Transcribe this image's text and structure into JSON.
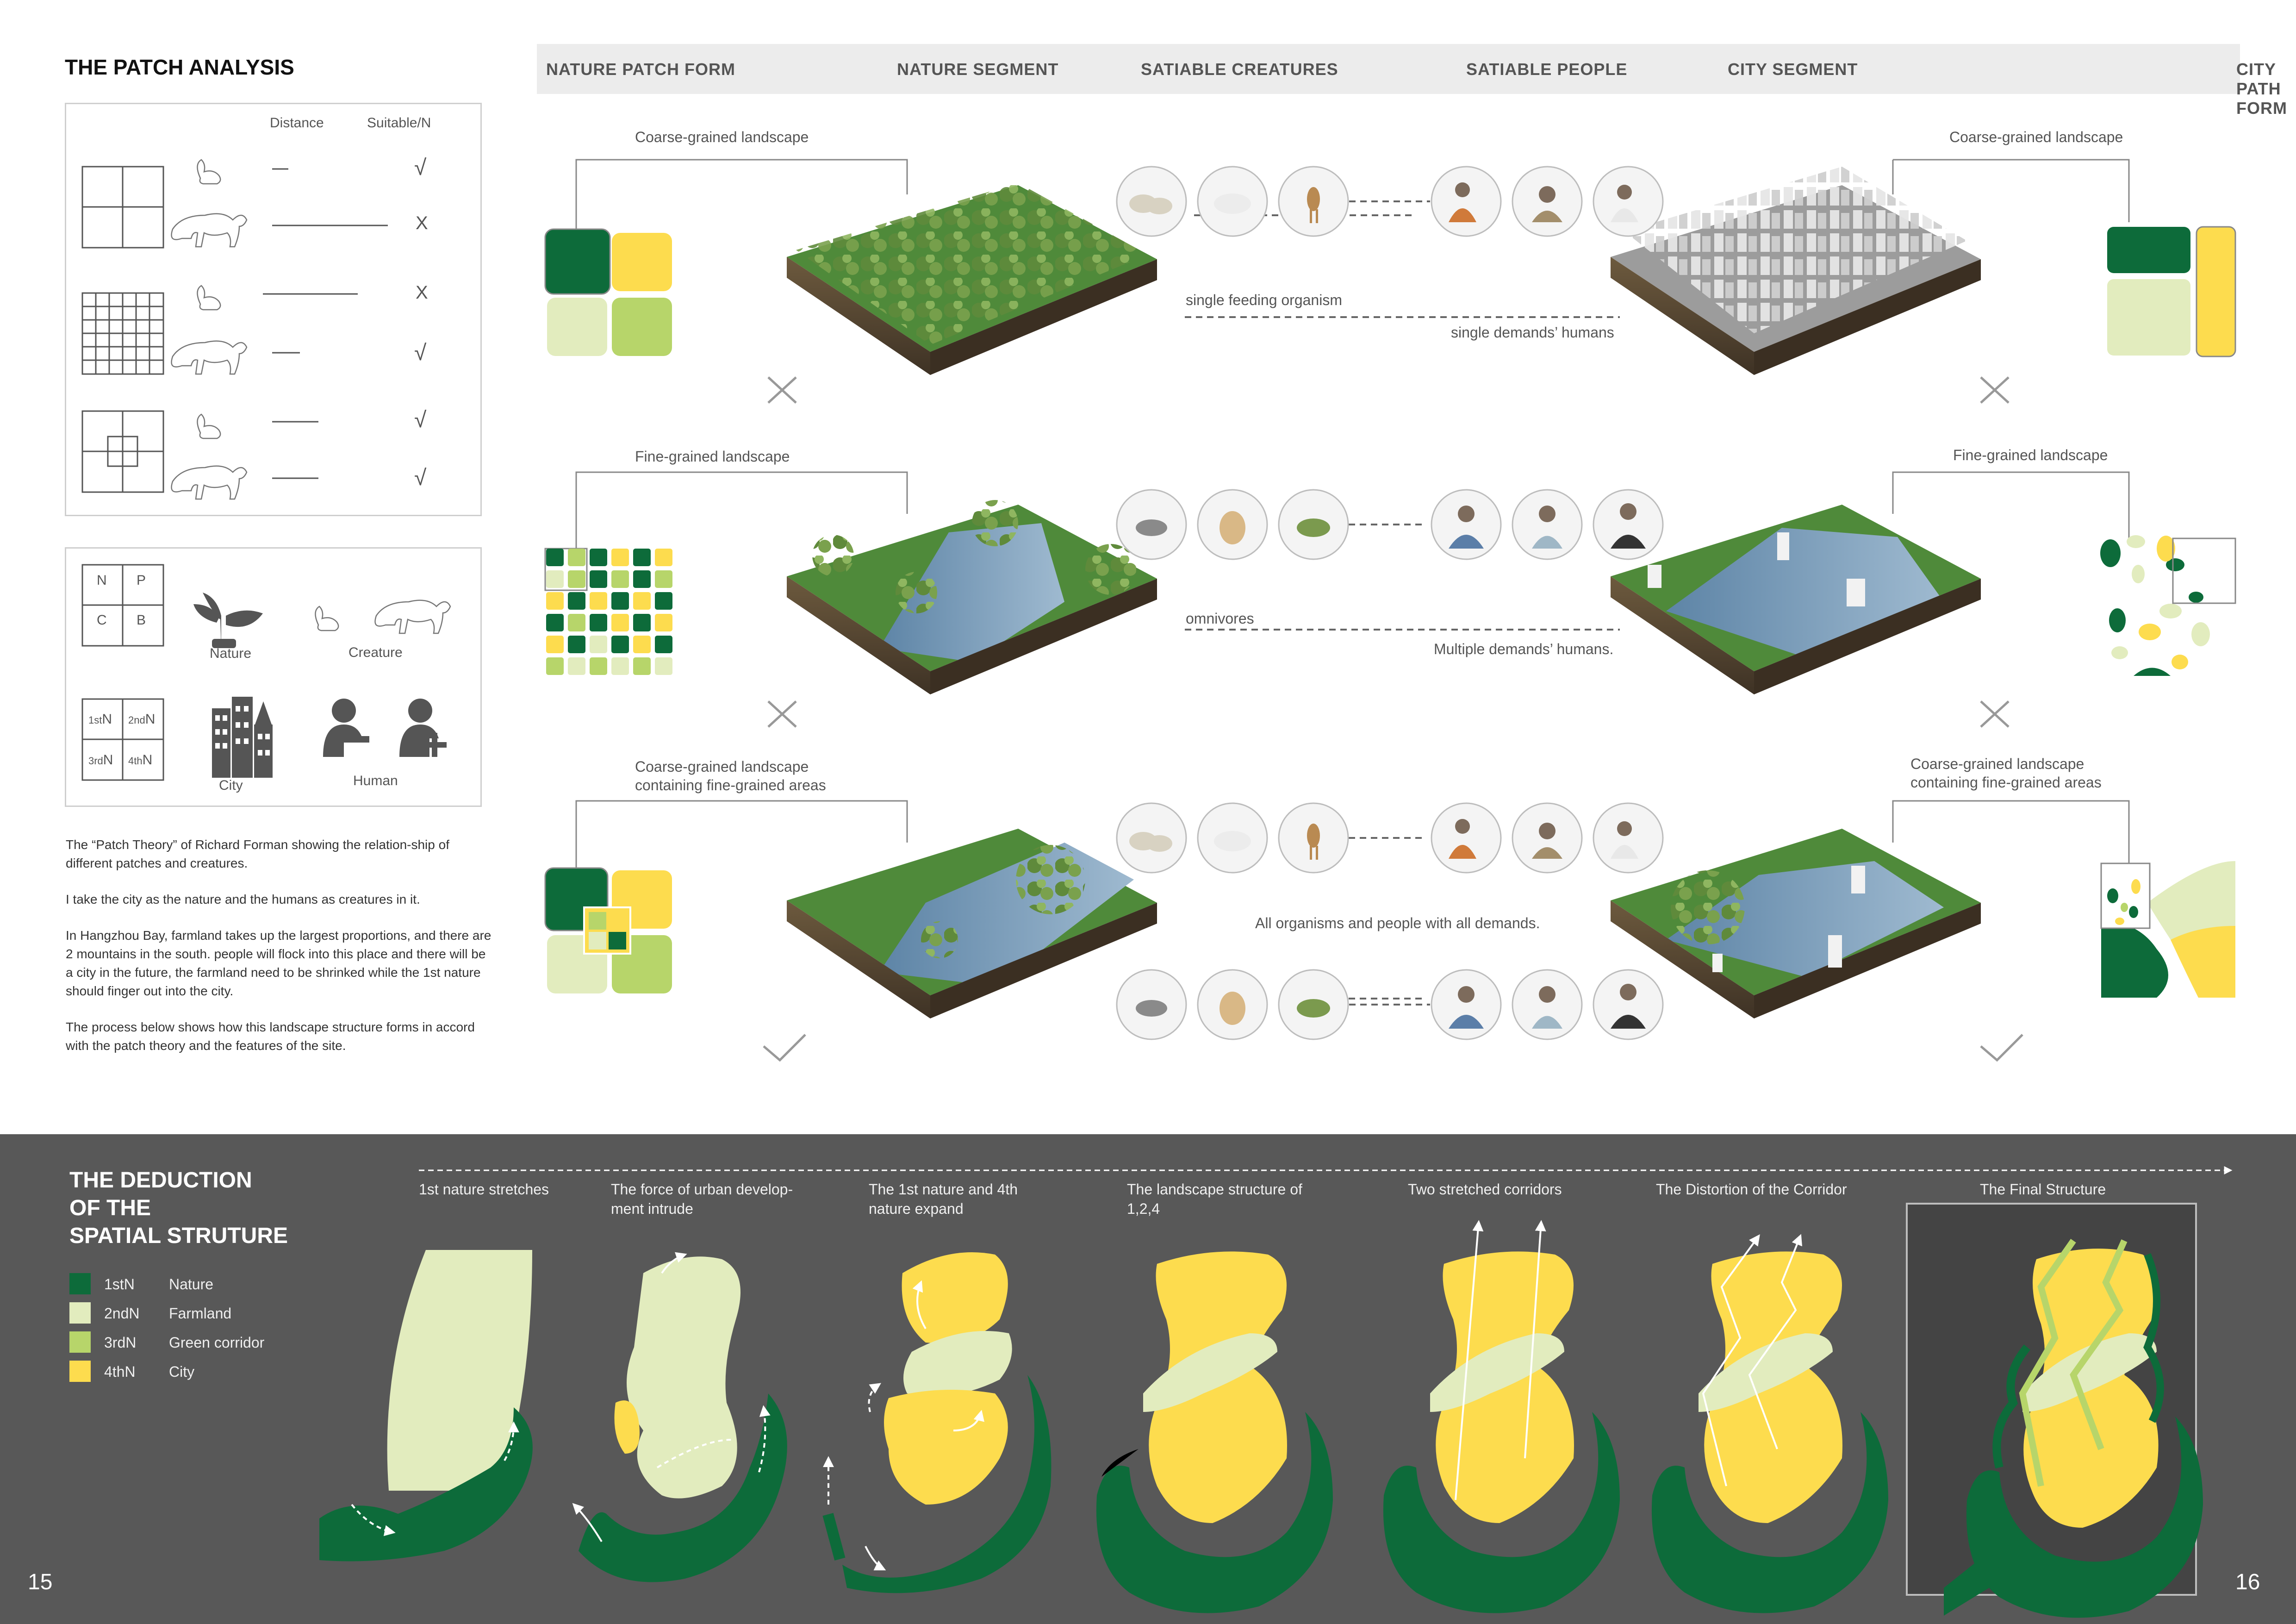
{
  "patch_analysis": {
    "title": "THE PATCH ANALYSIS",
    "col_distance": "Distance",
    "col_suitable": "Suitable/N",
    "rows": [
      {
        "animal": "rabbit-icon",
        "mark": "√"
      },
      {
        "animal": "cougar-icon",
        "mark": "X"
      },
      {
        "animal": "rabbit-icon",
        "mark": "X"
      },
      {
        "animal": "cougar-icon",
        "mark": "√"
      },
      {
        "animal": "rabbit-icon",
        "mark": "√"
      },
      {
        "animal": "cougar-icon",
        "mark": "√"
      }
    ]
  },
  "legend_box": {
    "grid_labels": [
      "N",
      "P",
      "C",
      "B"
    ],
    "nature_label": "Nature",
    "creature_label": "Creature",
    "grid2_labels": [
      "1st",
      "N",
      "2nd",
      "N",
      "3rd",
      "N",
      "4th",
      "N"
    ],
    "city_label": "City",
    "human_label": "Human"
  },
  "text_paragraphs": [
    "The “Patch Theory” of Richard Forman showing the relation-ship of different patches and creatures.",
    "I take the city as the nature and the humans as creatures in it.",
    "In Hangzhou Bay, farmland takes up the largest proportions, and there are 2 mountains in the south. people will flock into this place and there will be a city in the future, the farmland need to be shrinked while the 1st nature should finger out into the city.",
    "The process below shows how this landscape structure forms in accord with the patch theory and the features of the site."
  ],
  "header_columns": [
    "NATURE PATCH FORM",
    "NATURE SEGMENT",
    "SATIABLE CREATURES",
    "SATIABLE PEOPLE",
    "CITY SEGMENT",
    "CITY PATH FORM"
  ],
  "rows": [
    {
      "left_label": "Coarse-grained landscape",
      "right_label": "Coarse-grained landscape",
      "mid_top": "single feeding organism",
      "mid_bottom": "single demands’ humans",
      "mark": "✕"
    },
    {
      "left_label": "Fine-grained landscape",
      "right_label": "Fine-grained landscape",
      "mid_top": "omnivores",
      "mid_bottom": "Multiple demands’ humans.",
      "mark": "✕"
    },
    {
      "left_label": "Coarse-grained landscape containing fine-grained areas",
      "right_label": "Coarse-grained landscape containing fine-grained areas",
      "mid_top": "All organisms and people with all demands.",
      "mid_bottom": "",
      "mark": "✓"
    }
  ],
  "deduction": {
    "title_lines": [
      "THE DEDUCTION",
      "OF THE",
      "SPATIAL STRUTURE"
    ],
    "legend": [
      {
        "code": "1stN",
        "name": "Nature",
        "color": "#0d6b3a"
      },
      {
        "code": "2ndN",
        "name": "Farmland",
        "color": "#e2ecbe"
      },
      {
        "code": "3rdN",
        "name": "Green corridor",
        "color": "#b7d56a"
      },
      {
        "code": "4thN",
        "name": "City",
        "color": "#fddc4e"
      }
    ],
    "steps": [
      "1st nature stretches",
      "The force of urban develop-ment intrude",
      "The 1st nature and 4th nature expand",
      "The landscape structure of 1,2,4",
      "Two stretched corridors",
      "The Distortion of the Corridor",
      "The Final Structure"
    ]
  },
  "page_numbers": {
    "left": "15",
    "right": "16"
  },
  "colors": {
    "nature": "#0d6b3a",
    "farmland": "#e2ecbe",
    "corridor": "#b7d56a",
    "city": "#fddc4e",
    "bottom_bg": "#585858"
  }
}
